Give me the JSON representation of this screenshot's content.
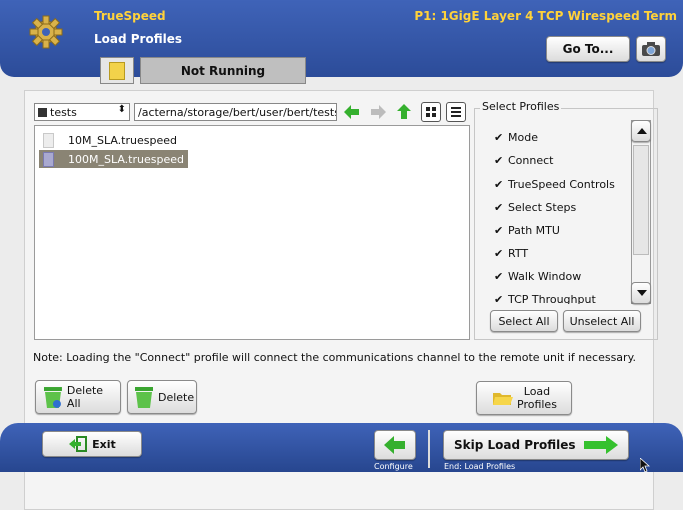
{
  "header": {
    "app_title": "TrueSpeed",
    "page_title": "Load Profiles",
    "port_title": "P1: 1GigE Layer 4 TCP Wirespeed Term",
    "goto_label": "Go To...",
    "camera_icon": "camera-icon",
    "gear_icon": "gear-icon"
  },
  "status": {
    "text": "Not Running"
  },
  "browser": {
    "folder": "tests",
    "path": "/acterna/storage/bert/user/bert/tests",
    "files": [
      {
        "name": "10M_SLA.truespeed",
        "selected": false
      },
      {
        "name": "100M_SLA.truespeed",
        "selected": true
      }
    ]
  },
  "profiles": {
    "label": "Select Profiles",
    "items": [
      {
        "label": "Mode",
        "checked": true
      },
      {
        "label": "Connect",
        "checked": true
      },
      {
        "label": "TrueSpeed Controls",
        "checked": true
      },
      {
        "label": "Select Steps",
        "checked": true
      },
      {
        "label": "Path MTU",
        "checked": true
      },
      {
        "label": "RTT",
        "checked": true
      },
      {
        "label": "Walk Window",
        "checked": true
      },
      {
        "label": "TCP Throughput",
        "checked": true
      }
    ],
    "select_all": "Select All",
    "unselect_all": "Unselect All"
  },
  "note": "Note: Loading the \"Connect\" profile will connect the communications channel to the remote unit if necessary.",
  "actions": {
    "delete_all": "Delete All",
    "delete": "Delete",
    "load_line1": "Load",
    "load_line2": "Profiles"
  },
  "footer": {
    "exit": "Exit",
    "configure": "Configure",
    "skip": "Skip Load Profiles",
    "skip_sub": "End: Load Profiles"
  },
  "colors": {
    "header_blue": "#3f63b8",
    "title_yellow": "#ffd23a",
    "arrow_green": "#35b02e",
    "selected_row": "#8a8474"
  }
}
